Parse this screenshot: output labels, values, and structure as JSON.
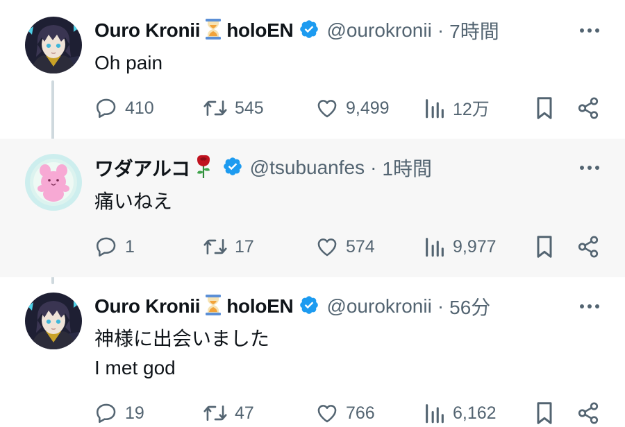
{
  "tweets": [
    {
      "name": "Ouro Kronii",
      "affiliation": "holoEN",
      "name_emoji": "hourglass-icon",
      "handle": "@ourokronii",
      "separator": "·",
      "time": "7時間",
      "lines": [
        "Oh pain"
      ],
      "replies": "410",
      "retweets": "545",
      "likes": "9,499",
      "views": "12万"
    },
    {
      "name": "ワダアルコ",
      "name_emoji": "rose-icon",
      "handle": "@tsubuanfes",
      "separator": "·",
      "time": "1時間",
      "lines": [
        "痛いねえ"
      ],
      "replies": "1",
      "retweets": "17",
      "likes": "574",
      "views": "9,977"
    },
    {
      "name": "Ouro Kronii",
      "affiliation": "holoEN",
      "name_emoji": "hourglass-icon",
      "handle": "@ourokronii",
      "separator": "·",
      "time": "56分",
      "lines": [
        "神様に出会いました",
        "I met god"
      ],
      "replies": "19",
      "retweets": "47",
      "likes": "766",
      "views": "6,162"
    }
  ],
  "colors": {
    "verified": "#1d9bf0",
    "secondary_text": "#536471",
    "thread_line": "#cfd9de",
    "highlight_bg": "#f7f7f7"
  }
}
